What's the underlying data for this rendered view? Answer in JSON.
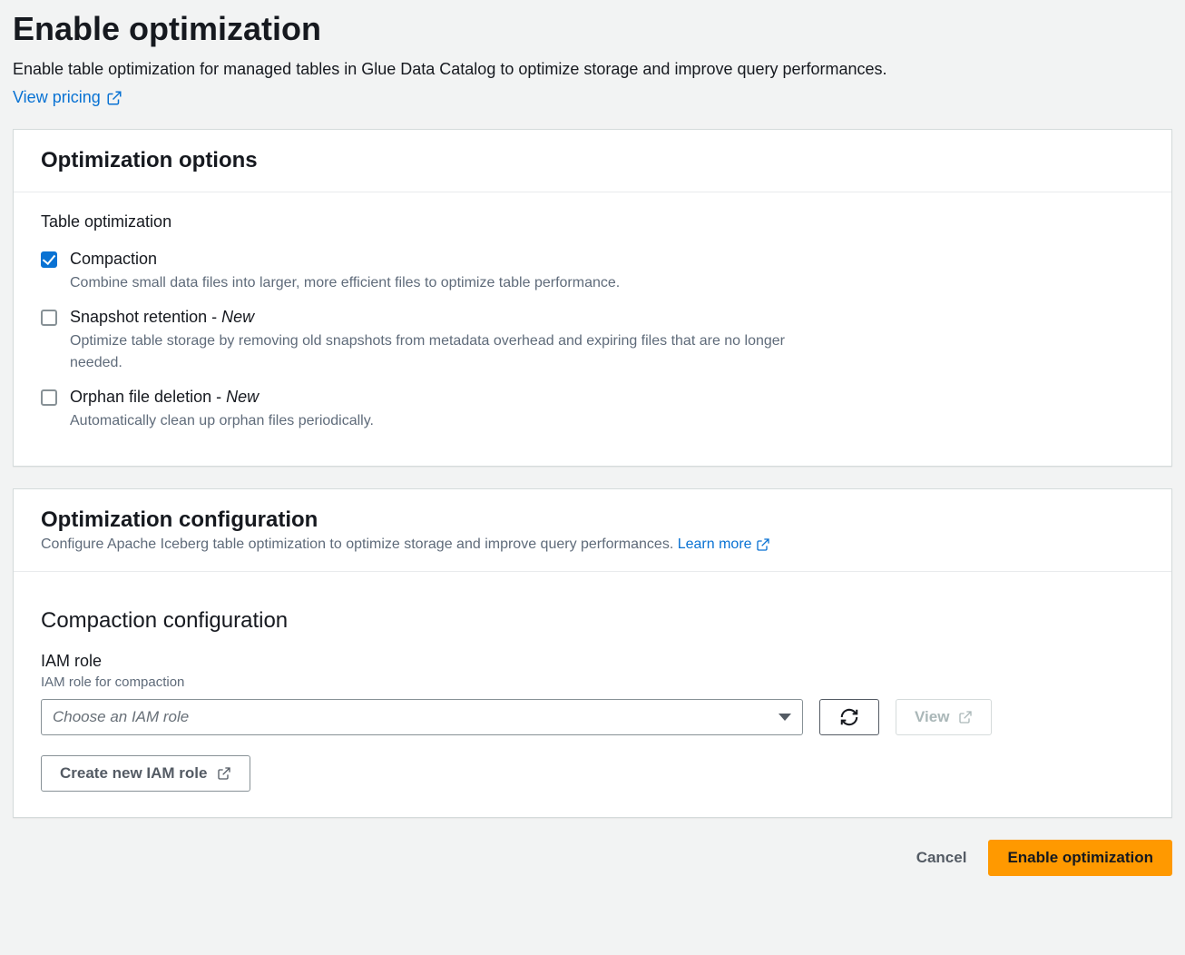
{
  "header": {
    "title": "Enable optimization",
    "subtitle": "Enable table optimization for managed tables in Glue Data Catalog to optimize storage and improve query performances.",
    "pricing_link": "View pricing"
  },
  "options_card": {
    "title": "Optimization options",
    "section_label": "Table optimization",
    "options": [
      {
        "label": "Compaction",
        "badge": "",
        "description": "Combine small data files into larger, more efficient files to optimize table performance.",
        "checked": true
      },
      {
        "label": "Snapshot retention",
        "badge": "New",
        "description": "Optimize table storage by removing old snapshots from metadata overhead and expiring files that are no longer needed.",
        "checked": false
      },
      {
        "label": "Orphan file deletion",
        "badge": "New",
        "description": "Automatically clean up orphan files periodically.",
        "checked": false
      }
    ]
  },
  "config_card": {
    "title": "Optimization configuration",
    "subtitle": "Configure Apache Iceberg table optimization to optimize storage and improve query performances.",
    "learn_more": "Learn more",
    "subsection_title": "Compaction configuration",
    "iam_label": "IAM role",
    "iam_help": "IAM role for compaction",
    "iam_placeholder": "Choose an IAM role",
    "view_button": "View",
    "create_role_button": "Create new IAM role"
  },
  "footer": {
    "cancel": "Cancel",
    "submit": "Enable optimization"
  }
}
